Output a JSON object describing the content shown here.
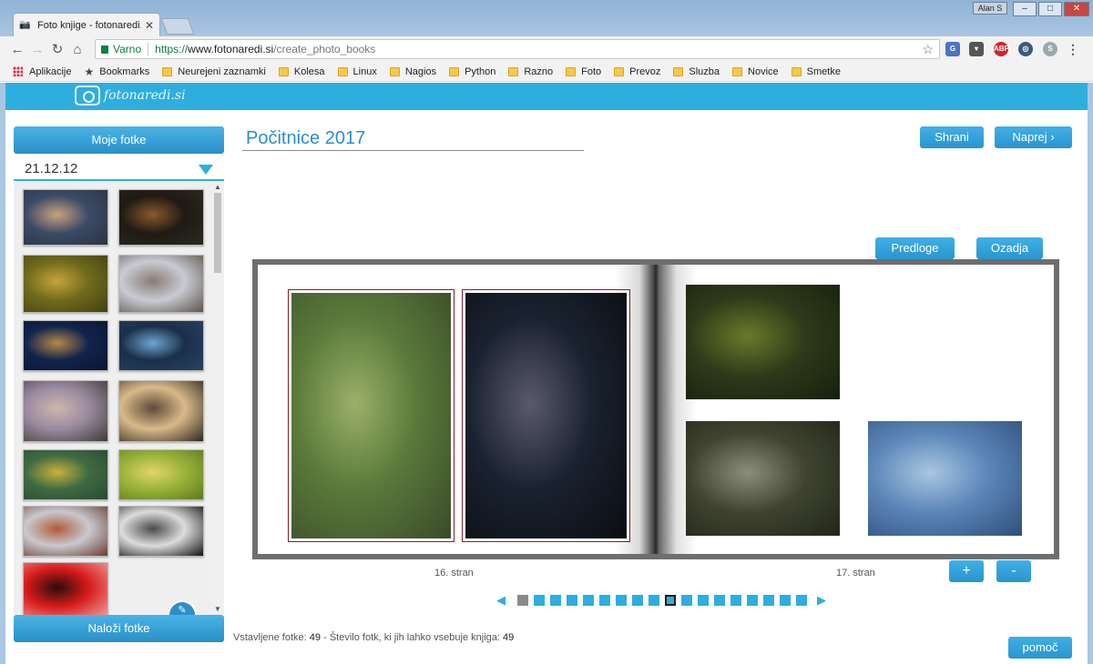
{
  "browser": {
    "tab_title": "Foto knjige - fotonaredi.s",
    "tab_close": "✕",
    "user_badge": "Alan S",
    "secure_label": "Varno",
    "url_https": "https://",
    "url_host": "www.fotonaredi.si",
    "url_path": "/create_photo_books",
    "extensions": {
      "adblock": "ABP"
    },
    "bookmarks": [
      {
        "label": "Aplikacije",
        "type": "apps"
      },
      {
        "label": "Bookmarks",
        "type": "star"
      },
      {
        "label": "Neurejeni zaznamki",
        "type": "folder"
      },
      {
        "label": "Kolesa",
        "type": "folder"
      },
      {
        "label": "Linux",
        "type": "folder"
      },
      {
        "label": "Nagios",
        "type": "folder"
      },
      {
        "label": "Python",
        "type": "folder"
      },
      {
        "label": "Razno",
        "type": "folder"
      },
      {
        "label": "Foto",
        "type": "folder"
      },
      {
        "label": "Prevoz",
        "type": "folder"
      },
      {
        "label": "Sluzba",
        "type": "folder"
      },
      {
        "label": "Novice",
        "type": "folder"
      },
      {
        "label": "Smetke",
        "type": "folder"
      }
    ]
  },
  "site": {
    "logo_text": "fotonaredi.si",
    "accent": "#2eaede"
  },
  "sidebar": {
    "my_photos_label": "Moje fotke",
    "date_value": "21.12.12",
    "upload_label": "Naloži fotke",
    "thumbnails": [
      {
        "subject": "mountains at dusk",
        "colors": [
          "#3b4a66",
          "#c9a27e",
          "#2c3340"
        ]
      },
      {
        "subject": "tree at night",
        "colors": [
          "#1f1a14",
          "#8a5a2a",
          "#2a2a20"
        ]
      },
      {
        "subject": "frog in green",
        "colors": [
          "#6f6a1c",
          "#c7a43b",
          "#41420f"
        ]
      },
      {
        "subject": "town panorama",
        "colors": [
          "#c8cbd4",
          "#8a7c70",
          "#5d5248"
        ]
      },
      {
        "subject": "town square night",
        "colors": [
          "#11234d",
          "#b48a45",
          "#0b1630"
        ]
      },
      {
        "subject": "aquarium",
        "colors": [
          "#1b2f4a",
          "#6fa6cf",
          "#28425f"
        ]
      },
      {
        "subject": "church and tower",
        "colors": [
          "#9a8aa0",
          "#cdb7ad",
          "#3d3a36"
        ]
      },
      {
        "subject": "railway at sunset",
        "colors": [
          "#d9b98a",
          "#5d4a38",
          "#2e271f"
        ]
      },
      {
        "subject": "yellow flowers",
        "colors": [
          "#3f6a43",
          "#c9b23a",
          "#2a4a30"
        ]
      },
      {
        "subject": "green leaves",
        "colors": [
          "#9bb33b",
          "#e3d46a",
          "#5c7a1e"
        ]
      },
      {
        "subject": "old town roofs",
        "colors": [
          "#c8c9cf",
          "#b15a3a",
          "#6b3b2a"
        ]
      },
      {
        "subject": "train black and white",
        "colors": [
          "#dcdcdc",
          "#4a4a4a",
          "#111111"
        ]
      },
      {
        "subject": "concert singer",
        "colors": [
          "#d71b1b",
          "#2a0c0c",
          "#f2a2a2"
        ]
      }
    ]
  },
  "editor": {
    "album_title": "Počitnice 2017",
    "save_label": "Shrani",
    "next_label": "Naprej",
    "templates_label": "Predloge",
    "backgrounds_label": "Ozadja",
    "zoom_in_label": "+",
    "zoom_out_label": "-",
    "left_page_label": "16. stran",
    "right_page_label": "17. stran",
    "help_label": "pomoč",
    "pager": {
      "prev": "◀",
      "next": "▶",
      "pages": 18,
      "current_index": 9
    },
    "status": {
      "inserted_label": "Vstavljene fotke:",
      "inserted_count": "49",
      "separator": "-",
      "capacity_label": "Število fotk, ki jih lahko vsebuje knjiga:",
      "capacity_count": "49"
    },
    "photos": {
      "left": [
        {
          "subject": "grasshopper on stem",
          "colors": [
            "#5a7a3a",
            "#9bb06a",
            "#3b4a2a"
          ]
        },
        {
          "subject": "milky way night sky",
          "colors": [
            "#1a2230",
            "#5a5a6a",
            "#0a0d12"
          ]
        }
      ],
      "right": [
        {
          "subject": "frog in water",
          "colors": [
            "#2d3a1a",
            "#6a7a2a",
            "#171f0d"
          ]
        },
        {
          "subject": "catfish underwater",
          "colors": [
            "#3f4330",
            "#8a8f7a",
            "#222619"
          ]
        },
        {
          "subject": "spider on web",
          "colors": [
            "#5b86b8",
            "#a9c6e2",
            "#2f4f7a"
          ]
        }
      ]
    }
  }
}
